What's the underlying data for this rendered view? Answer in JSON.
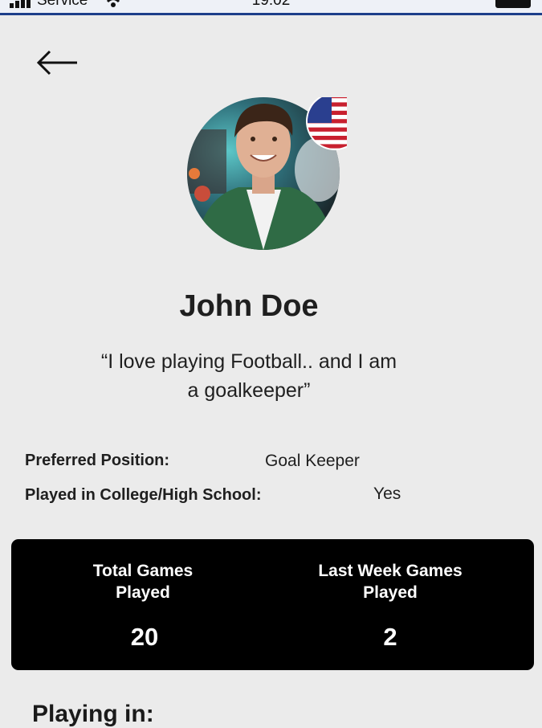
{
  "status_bar": {
    "carrier": "Service",
    "time": "19:02"
  },
  "profile": {
    "name": "John Doe",
    "bio_line1": "“I love playing Football.. and I am",
    "bio_line2": "a goalkeeper”",
    "country_flag": "us-flag-icon"
  },
  "details": {
    "position_label": "Preferred Position:",
    "position_value": "Goal Keeper",
    "college_label": "Played in College/High School:",
    "college_value": "Yes"
  },
  "stats": {
    "total_label_1": "Total Games",
    "total_label_2": "Played",
    "total_value": "20",
    "week_label_1": "Last Week Games",
    "week_label_2": "Played",
    "week_value": "2"
  },
  "playing_in": {
    "heading": "Playing in:"
  },
  "colors": {
    "background": "#ebebeb",
    "stats_card": "#000000",
    "status_bar_accent": "#1d3e8a"
  }
}
